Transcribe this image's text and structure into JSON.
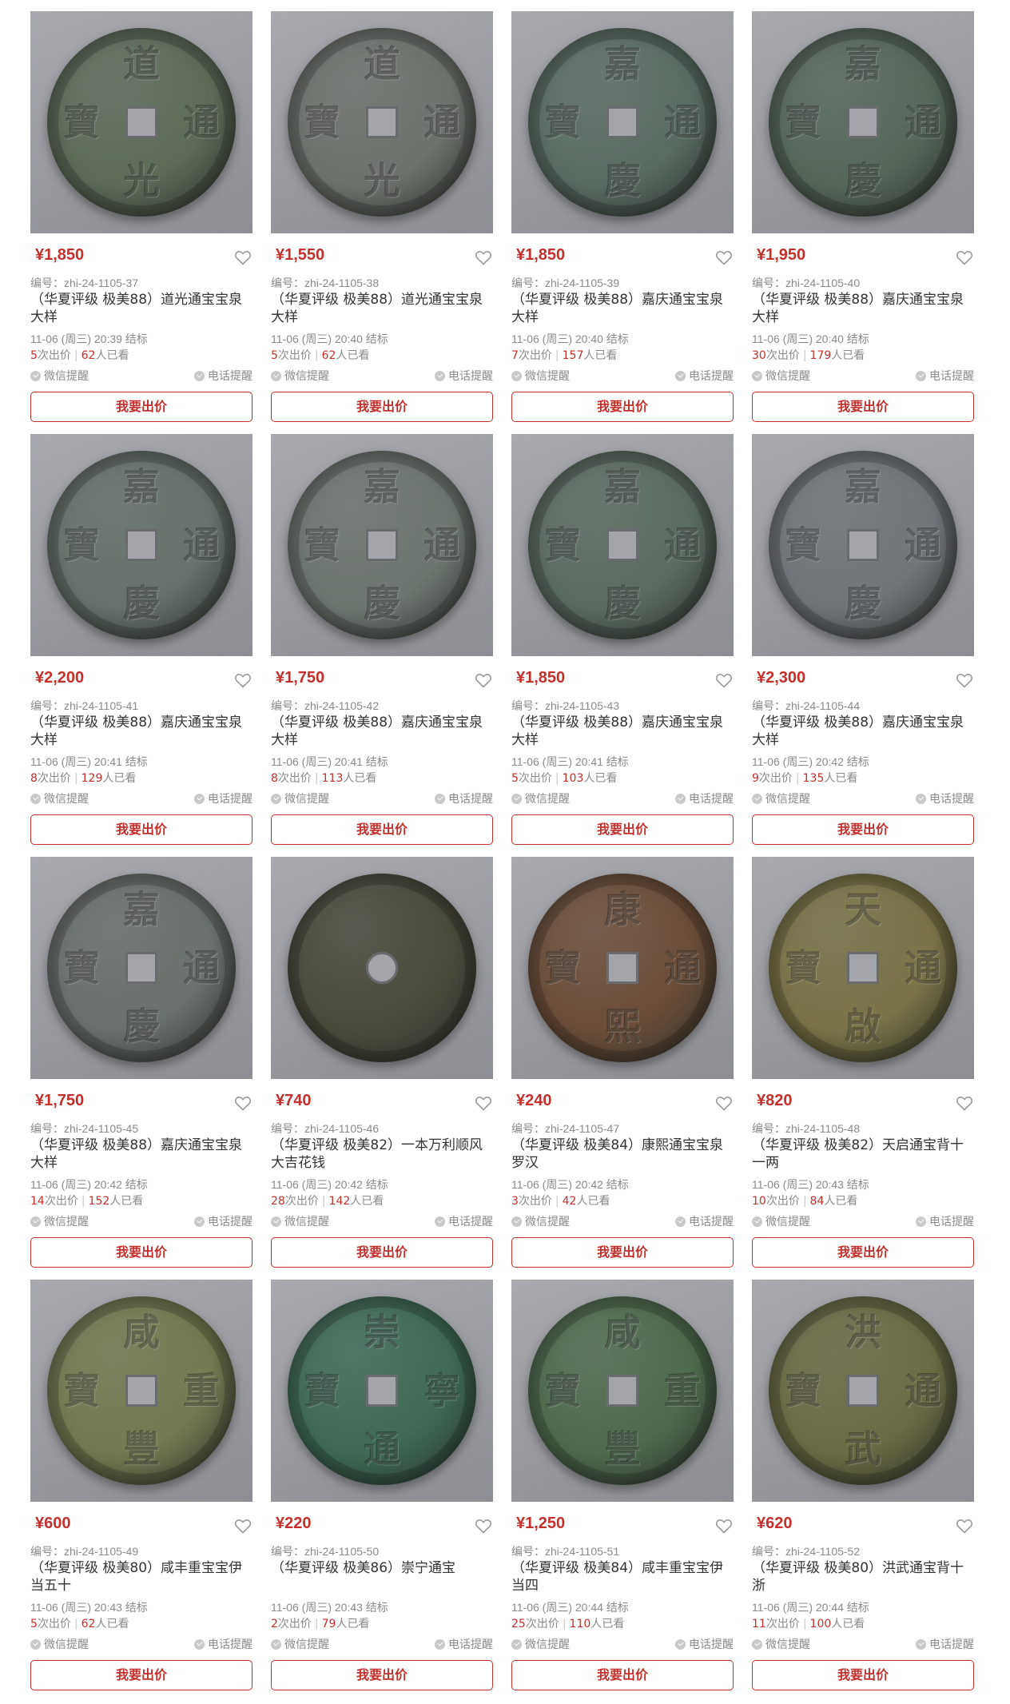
{
  "labels": {
    "code_prefix": "编号：",
    "bids_suffix": "次出价",
    "views_suffix": "人已看",
    "wechat": "微信提醒",
    "phone": "电话提醒",
    "bid_button": "我要出价"
  },
  "colors": {
    "accent": "#c4302b",
    "muted": "#8a8a8a"
  },
  "items": [
    {
      "price": "¥1,850",
      "code": "zhi-24-1105-37",
      "title": "（华夏评级 极美88）道光通宝宝泉大样",
      "time": "11-06 (周三) 20:39 结标",
      "bids": "5",
      "views": "62",
      "coin": [
        "道",
        "光",
        "寶",
        "通"
      ],
      "tint": "#5d6b58"
    },
    {
      "price": "¥1,550",
      "code": "zhi-24-1105-38",
      "title": "（华夏评级 极美88）道光通宝宝泉大样",
      "time": "11-06 (周三) 20:40 结标",
      "bids": "5",
      "views": "62",
      "coin": [
        "道",
        "光",
        "寶",
        "通"
      ],
      "tint": "#6d736c"
    },
    {
      "price": "¥1,850",
      "code": "zhi-24-1105-39",
      "title": "（华夏评级 极美88）嘉庆通宝宝泉大样",
      "time": "11-06 (周三) 20:40 结标",
      "bids": "7",
      "views": "157",
      "coin": [
        "嘉",
        "慶",
        "寶",
        "通"
      ],
      "tint": "#5a6c62"
    },
    {
      "price": "¥1,950",
      "code": "zhi-24-1105-40",
      "title": "（华夏评级 极美88）嘉庆通宝宝泉大样",
      "time": "11-06 (周三) 20:40 结标",
      "bids": "30",
      "views": "179",
      "coin": [
        "嘉",
        "慶",
        "寶",
        "通"
      ],
      "tint": "#56675a"
    },
    {
      "price": "¥2,200",
      "code": "zhi-24-1105-41",
      "title": "（华夏评级 极美88）嘉庆通宝宝泉大样",
      "time": "11-06 (周三) 20:41 结标",
      "bids": "8",
      "views": "129",
      "coin": [
        "嘉",
        "慶",
        "寶",
        "通"
      ],
      "tint": "#66716b"
    },
    {
      "price": "¥1,750",
      "code": "zhi-24-1105-42",
      "title": "（华夏评级 极美88）嘉庆通宝宝泉大样",
      "time": "11-06 (周三) 20:41 结标",
      "bids": "8",
      "views": "113",
      "coin": [
        "嘉",
        "慶",
        "寶",
        "通"
      ],
      "tint": "#6e7670"
    },
    {
      "price": "¥1,850",
      "code": "zhi-24-1105-43",
      "title": "（华夏评级 极美88）嘉庆通宝宝泉大样",
      "time": "11-06 (周三) 20:41 结标",
      "bids": "5",
      "views": "103",
      "coin": [
        "嘉",
        "慶",
        "寶",
        "通"
      ],
      "tint": "#5b6b60"
    },
    {
      "price": "¥2,300",
      "code": "zhi-24-1105-44",
      "title": "（华夏评级 极美88）嘉庆通宝宝泉大样",
      "time": "11-06 (周三) 20:42 结标",
      "bids": "9",
      "views": "135",
      "coin": [
        "嘉",
        "慶",
        "寶",
        "通"
      ],
      "tint": "#70767a"
    },
    {
      "price": "¥1,750",
      "code": "zhi-24-1105-45",
      "title": "（华夏评级 极美88）嘉庆通宝宝泉大样",
      "time": "11-06 (周三) 20:42 结标",
      "bids": "14",
      "views": "152",
      "coin": [
        "嘉",
        "慶",
        "寶",
        "通"
      ],
      "tint": "#6a716d"
    },
    {
      "price": "¥740",
      "code": "zhi-24-1105-46",
      "title": "（华夏评级 极美82）一本万利顺风大吉花钱",
      "time": "11-06 (周三) 20:42 结标",
      "bids": "28",
      "views": "142",
      "coin": [
        "",
        "",
        "",
        ""
      ],
      "tint": "#4a4a3c",
      "round": true
    },
    {
      "price": "¥240",
      "code": "zhi-24-1105-47",
      "title": "（华夏评级 极美84）康熙通宝宝泉罗汉",
      "time": "11-06 (周三) 20:42 结标",
      "bids": "3",
      "views": "42",
      "coin": [
        "康",
        "熙",
        "寶",
        "通"
      ],
      "tint": "#6b4e3a"
    },
    {
      "price": "¥820",
      "code": "zhi-24-1105-48",
      "title": "（华夏评级 极美82）天启通宝背十一两",
      "time": "11-06 (周三) 20:43 结标",
      "bids": "10",
      "views": "84",
      "coin": [
        "天",
        "啟",
        "寶",
        "通"
      ],
      "tint": "#7a7346"
    },
    {
      "price": "¥600",
      "code": "zhi-24-1105-49",
      "title": "（华夏评级 极美80）咸丰重宝宝伊当五十",
      "time": "11-06 (周三) 20:43 结标",
      "bids": "5",
      "views": "62",
      "coin": [
        "咸",
        "豐",
        "寶",
        "重"
      ],
      "tint": "#747a52"
    },
    {
      "price": "¥220",
      "code": "zhi-24-1105-50",
      "title": "（华夏评级 极美86）崇宁通宝",
      "time": "11-06 (周三) 20:43 结标",
      "bids": "2",
      "views": "79",
      "coin": [
        "崇",
        "通",
        "寶",
        "寧"
      ],
      "tint": "#3f6a55"
    },
    {
      "price": "¥1,250",
      "code": "zhi-24-1105-51",
      "title": "（华夏评级 极美84）咸丰重宝宝伊当四",
      "time": "11-06 (周三) 20:44 结标",
      "bids": "25",
      "views": "110",
      "coin": [
        "咸",
        "豐",
        "寶",
        "重"
      ],
      "tint": "#4f6a4e"
    },
    {
      "price": "¥620",
      "code": "zhi-24-1105-52",
      "title": "（华夏评级 极美80）洪武通宝背十浙",
      "time": "11-06 (周三) 20:44 结标",
      "bids": "11",
      "views": "100",
      "coin": [
        "洪",
        "武",
        "寶",
        "通"
      ],
      "tint": "#6a6b45"
    }
  ]
}
